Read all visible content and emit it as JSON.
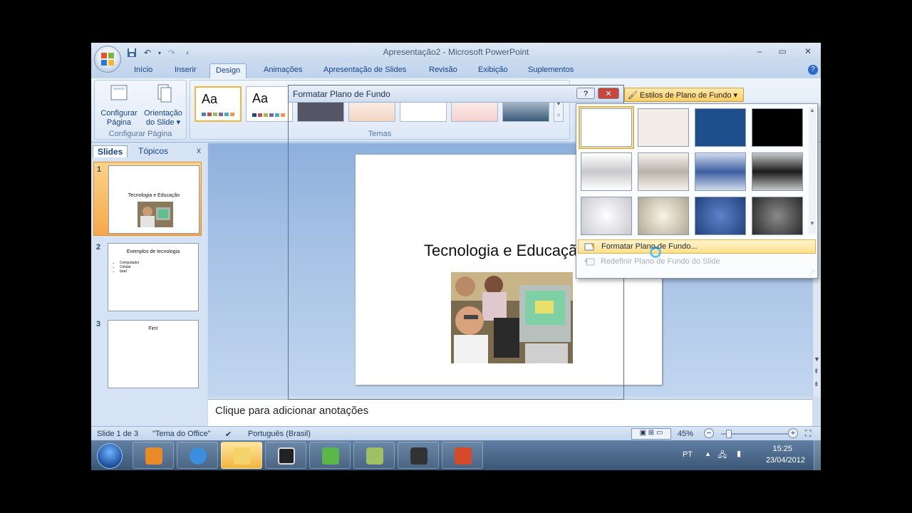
{
  "window": {
    "title": "Apresentação2 - Microsoft PowerPoint",
    "controls": [
      "–",
      "▭",
      "✕"
    ]
  },
  "tabs": [
    "Início",
    "Inserir",
    "Design",
    "Animações",
    "Apresentação de Slides",
    "Revisão",
    "Exibição",
    "Suplementos"
  ],
  "active_tab": "Design",
  "ribbon": {
    "page_setup_label": "Configurar Página",
    "page_setup_button": [
      "Configurar",
      "Página"
    ],
    "orientation_button": [
      "Orientação",
      "do Slide"
    ],
    "themes_label": "Temas",
    "theme_aa": "Aa",
    "background_styles_button": "Estilos de Plano de Fundo"
  },
  "left_panel": {
    "tab_slides": "Slides",
    "tab_topics": "Tópicos",
    "close": "x",
    "thumbs": [
      {
        "num": "1",
        "title": "Tecnologia e Educação"
      },
      {
        "num": "2",
        "title": "Exemplos de tecnologia",
        "bullets": [
          "Computador",
          "Celular",
          "Ipad"
        ]
      },
      {
        "num": "3",
        "title": "Fim!"
      }
    ]
  },
  "slide": {
    "title": "Tecnologia e Educação"
  },
  "notes_placeholder": "Clique para adicionar anotações",
  "dialog": {
    "title": "Formatar Plano de Fundo",
    "help": "?",
    "close": "✕"
  },
  "gallery": {
    "colors": [
      "#ffffff",
      "#f2ece7",
      "#1f4e8c",
      "#000000"
    ],
    "menu": {
      "format": "Formatar Plano de Fundo...",
      "reset": "Redefinir Plano de Fundo do Slide"
    }
  },
  "status": {
    "slide_of": "Slide 1 de 3",
    "theme": "\"Tema do Office\"",
    "language": "Português (Brasil)",
    "zoom": "45%",
    "zoom_level": 0.45
  },
  "taskbar": {
    "language": "PT",
    "time": "15:25",
    "date": "23/04/2012"
  }
}
